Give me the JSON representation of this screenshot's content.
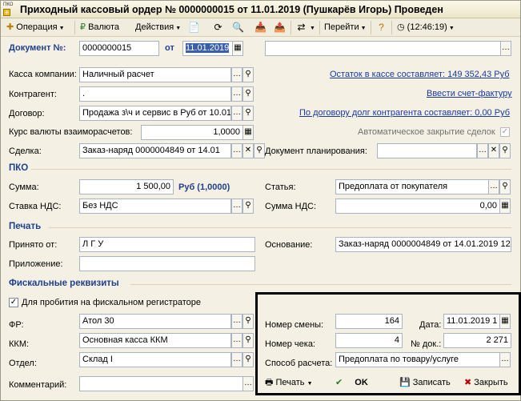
{
  "window": {
    "app_icon_text": "ПКО",
    "title": "Приходный кассовый ордер № 0000000015 от 11.01.2019 (Пушкарёв Игорь) Проведен"
  },
  "toolbar": {
    "operation": "Операция",
    "currency": "Валюта",
    "actions": "Действия",
    "goto": "Перейти",
    "time": "(12:46:19)"
  },
  "header": {
    "doc_no_label": "Документ №:",
    "doc_no": "0000000015",
    "from_label": "от",
    "date": "11.01.2019",
    "extra_value": ""
  },
  "form": {
    "cash_label": "Касса компании:",
    "cash": "Наличный расчет",
    "cash_balance": "Остаток в кассе составляет: 149 352,43 Руб",
    "counterparty_label": "Контрагент:",
    "counterparty": ".",
    "invoice_link": "Ввести счет-фактуру",
    "contract_label": "Договор:",
    "contract": "Продажа з\\ч и сервис в Руб от 10.01",
    "debt_link": "По договору долг контрагента составляет: 0,00 Руб",
    "rate_label": "Курс валюты взаиморасчетов:",
    "rate": "1,0000",
    "auto_close_label": "Автоматическое закрытие сделок",
    "deal_label": "Сделка:",
    "deal": "Заказ-наряд 0000004849 от 14.01",
    "plan_doc_label": "Документ планирования:",
    "plan_doc": ""
  },
  "pko": {
    "title": "ПКО",
    "sum_label": "Сумма:",
    "sum": "1 500,00",
    "sum_currency": "Руб (1,0000)",
    "article_label": "Статья:",
    "article": "Предоплата от покупателя",
    "vat_rate_label": "Ставка НДС:",
    "vat_rate": "Без НДС",
    "vat_sum_label": "Сумма НДС:",
    "vat_sum": "0,00"
  },
  "print": {
    "title": "Печать",
    "received_label": "Принято от:",
    "received": "Л                 Г        У",
    "basis_label": "Основание:",
    "basis": "Заказ-наряд 0000004849 от 14.01.2019 12",
    "attachment_label": "Приложение:",
    "attachment": ""
  },
  "fiscal": {
    "title": "Фискальные реквизиты",
    "register_label": "Для пробития на фискальном регистраторе",
    "fr_label": "ФР:",
    "fr": "Атол 30",
    "kkm_label": "ККМ:",
    "kkm": "Основная касса ККМ",
    "dept_label": "Отдел:",
    "dept": "Склад I",
    "shift_label": "Номер смены:",
    "shift": "164",
    "date_label": "Дата:",
    "date": "11.01.2019 1",
    "check_label": "Номер чека:",
    "check": "4",
    "doc_label": "№ док.:",
    "doc": "2 271",
    "payment_label": "Способ расчета:",
    "payment": "Предоплата по товару/услуге"
  },
  "footer": {
    "comment_label": "Комментарий:",
    "comment": "",
    "print": "Печать",
    "ok": "OK",
    "save": "Записать",
    "close": "Закрыть"
  }
}
